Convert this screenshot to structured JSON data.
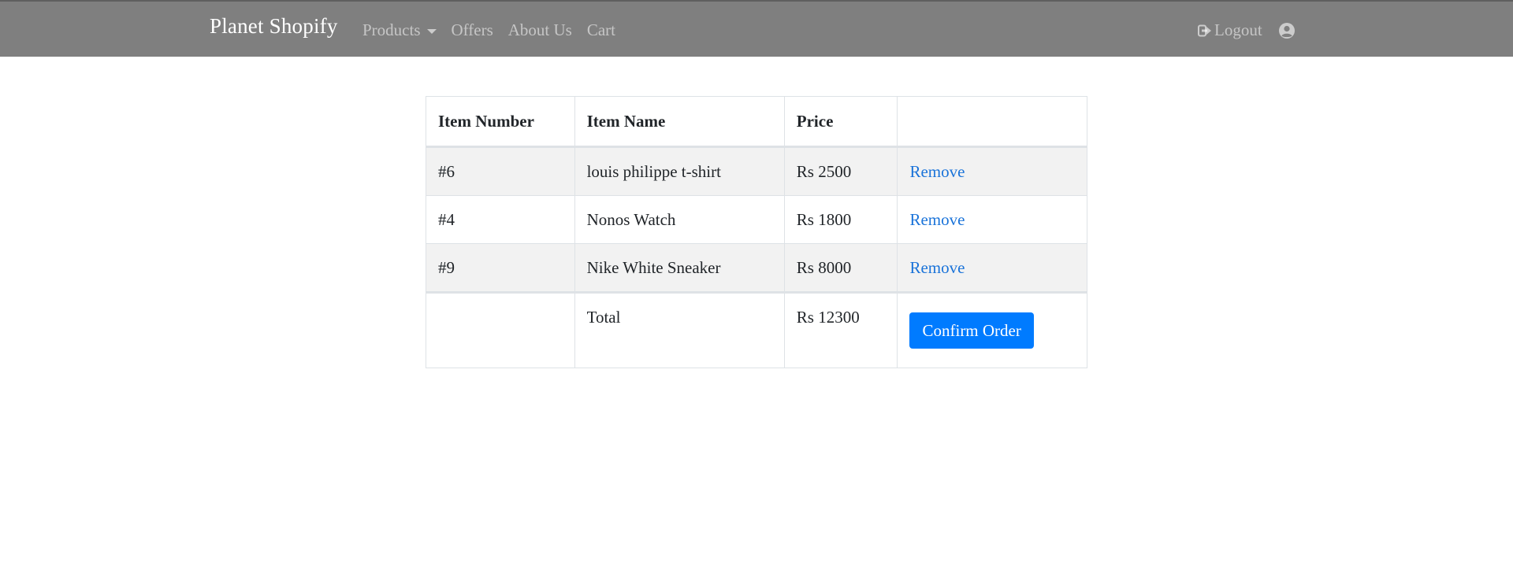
{
  "navbar": {
    "brand": "Planet Shopify",
    "links": [
      {
        "label": "Products",
        "dropdown": true
      },
      {
        "label": "Offers"
      },
      {
        "label": "About Us"
      },
      {
        "label": "Cart"
      }
    ],
    "logout_label": "Logout",
    "logout_icon": "sign-out-icon",
    "user_icon": "user-circle-icon",
    "background_color": "#7f7f7f"
  },
  "cart": {
    "headers": [
      "Item Number",
      "Item Name",
      "Price",
      ""
    ],
    "rows": [
      {
        "number": "#6",
        "name": "louis philippe t-shirt",
        "price": "Rs 2500",
        "action": "Remove"
      },
      {
        "number": "#4",
        "name": "Nonos Watch",
        "price": "Rs 1800",
        "action": "Remove"
      },
      {
        "number": "#9",
        "name": "Nike White Sneaker",
        "price": "Rs 8000",
        "action": "Remove"
      }
    ],
    "total_label": "Total",
    "total_value": "Rs 12300",
    "confirm_label": "Confirm Order",
    "link_color": "#1a73d9",
    "button_color": "#007bff"
  }
}
